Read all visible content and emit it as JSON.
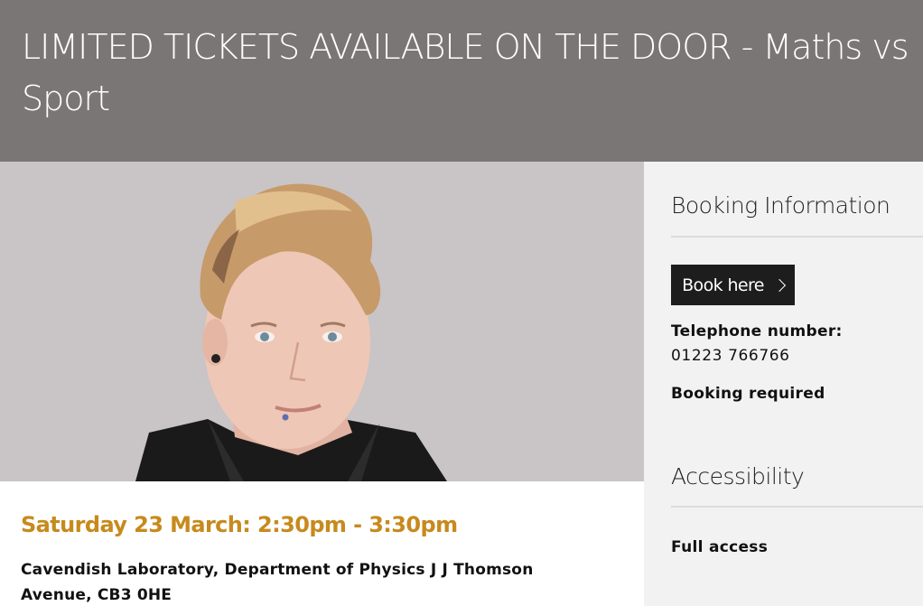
{
  "event": {
    "title": "LIMITED TICKETS AVAILABLE ON THE DOOR - Maths vs Sport",
    "date_time": "Saturday 23 March: 2:30pm - 3:30pm",
    "location": "Cavendish Laboratory, Department of Physics J J Thomson Avenue, CB3 0HE"
  },
  "booking": {
    "heading": "Booking Information",
    "book_button_label": "Book here",
    "telephone_label": "Telephone number:",
    "telephone_value": "01223 766766",
    "booking_note": "Booking required"
  },
  "accessibility": {
    "heading": "Accessibility",
    "value": "Full access"
  },
  "colors": {
    "header_bg": "#7b7676",
    "date_accent": "#c78a1d",
    "sidebar_bg": "#f2f2f2",
    "button_bg": "#1d1d1d"
  }
}
